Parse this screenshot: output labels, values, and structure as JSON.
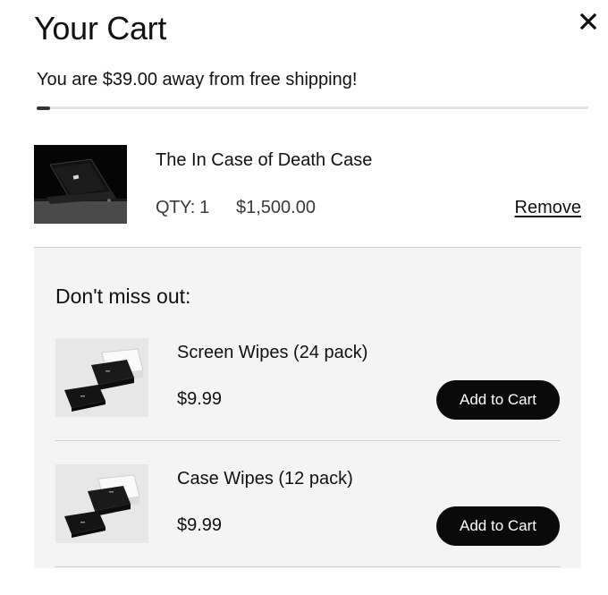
{
  "cart": {
    "title": "Your Cart",
    "close_icon": "close-icon"
  },
  "shipping": {
    "message": "You are $39.00 away from free shipping!",
    "progress_percent": 2.5
  },
  "cart_items": [
    {
      "name": "The In Case of Death Case",
      "qty_label": "QTY: 1",
      "price": "$1,500.00",
      "remove_label": "Remove"
    }
  ],
  "upsell": {
    "heading": "Don't miss out:",
    "items": [
      {
        "name": "Screen Wipes (24 pack)",
        "price": "$9.99",
        "button_label": "Add to Cart"
      },
      {
        "name": "Case Wipes (12 pack)",
        "price": "$9.99",
        "button_label": "Add to Cart"
      }
    ]
  }
}
